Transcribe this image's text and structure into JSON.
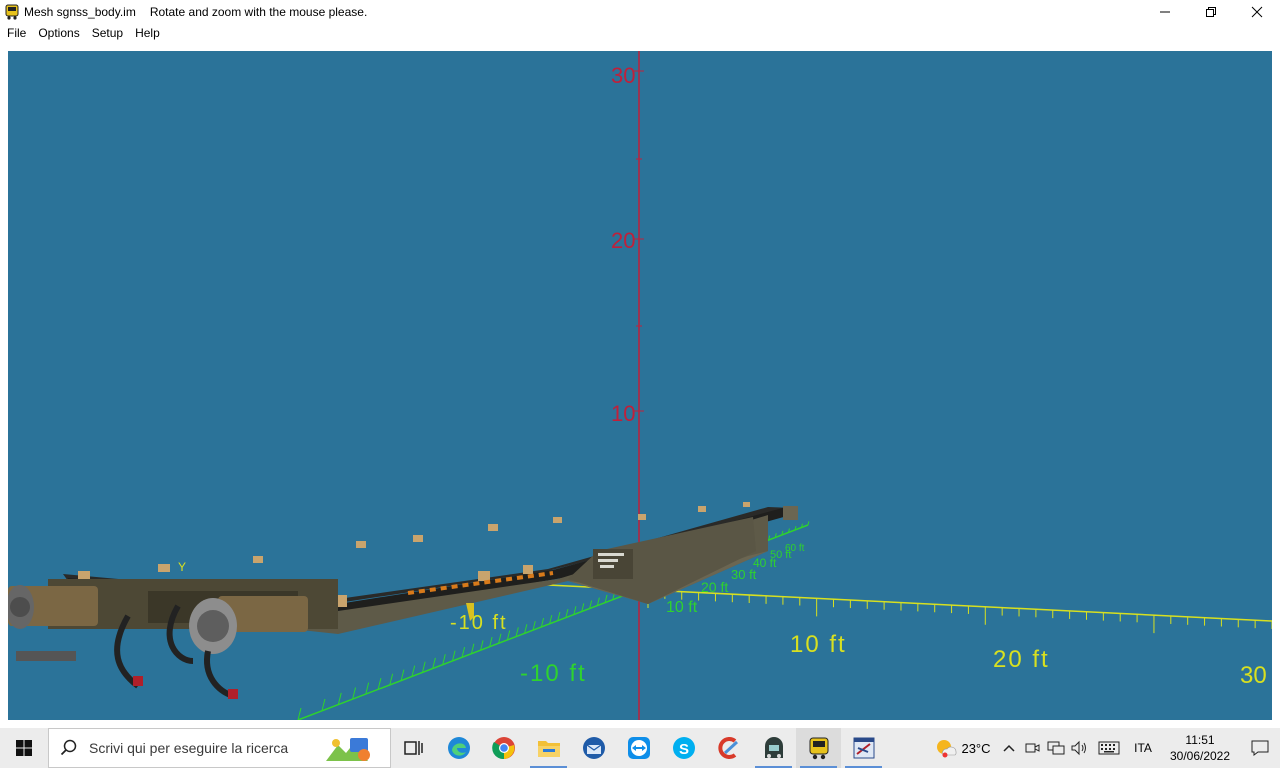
{
  "window": {
    "title": "Mesh sgnss_body.im",
    "hint": "Rotate and zoom with the mouse please.",
    "app_icon": "locomotive-icon",
    "controls": [
      "minimize-icon",
      "restore-icon",
      "close-icon"
    ]
  },
  "menu": {
    "items": [
      "File",
      "Options",
      "Setup",
      "Help"
    ]
  },
  "viewport": {
    "background": "#2b7399",
    "vertical_axis_color": "#c0203a",
    "x_axis_color": "#d8e020",
    "z_axis_color": "#2ed22e",
    "vertical_axis_labels": [
      "30",
      "20",
      "10"
    ],
    "x_axis_labels": [
      "10 ft",
      "20 ft",
      "30"
    ],
    "z_axis_labels_near": [
      "-10 ft",
      "-10 ft"
    ],
    "z_axis_labels_far": [
      "10 ft",
      "20 ft",
      "30 ft",
      "40 ft",
      "50 ft",
      "60 ft"
    ],
    "origin_label": "Y",
    "model": "flatcar-wagon-mesh"
  },
  "taskbar": {
    "search_placeholder": "Scrivi qui per eseguire la ricerca",
    "apps": [
      "task-view-icon",
      "edge-icon",
      "chrome-icon",
      "file-explorer-icon",
      "thunderbird-icon",
      "teamviewer-icon",
      "skype-icon",
      "ccleaner-icon",
      "railworks-icon",
      "locomotive-icon",
      "shape-viewer-icon"
    ],
    "weather": "23°C",
    "language": "ITA",
    "time": "11:51",
    "date": "30/06/2022"
  }
}
